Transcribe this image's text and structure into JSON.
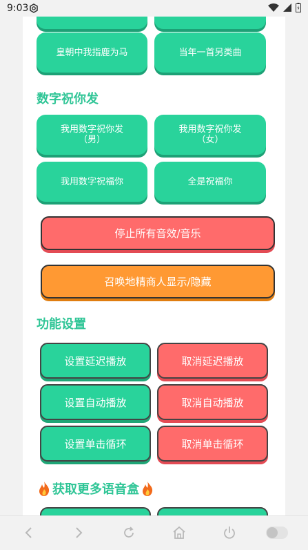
{
  "status": {
    "time": "9:03"
  },
  "section_top": {
    "buttons": [
      "皇朝中我指鹿为马",
      "当年一首另类曲"
    ]
  },
  "section_numbers": {
    "title": "数字祝你发",
    "buttons": [
      {
        "line1": "我用数字祝你发",
        "line2": "（男）"
      },
      {
        "line1": "我用数字祝你发",
        "line2": "（女）"
      },
      {
        "line1": "我用数字祝福你",
        "line2": ""
      },
      {
        "line1": "全是祝福你",
        "line2": ""
      }
    ]
  },
  "controls": {
    "stop_all": "停止所有音效/音乐",
    "summon": "召唤地精商人显示/隐藏"
  },
  "settings": {
    "title": "功能设置",
    "set_delay": "设置延迟播放",
    "cancel_delay": "取消延迟播放",
    "set_auto": "设置自动播放",
    "cancel_auto": "取消自动播放",
    "set_loop": "设置单击循环",
    "cancel_loop": "取消单击循环"
  },
  "more": {
    "title": "获取更多语音盒"
  },
  "colors": {
    "green": "#29d39b",
    "red": "#ff6b6b",
    "orange": "#ff9933",
    "title": "#2fc596"
  }
}
